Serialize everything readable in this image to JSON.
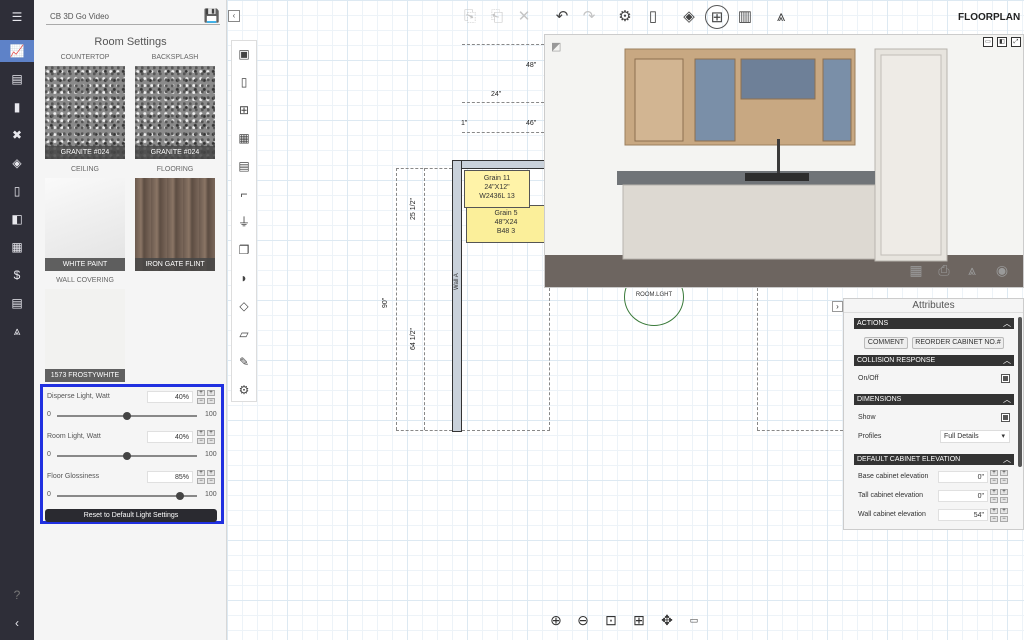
{
  "app": {
    "mode_label": "FLOORPLAN"
  },
  "project": {
    "name": "CB 3D Go Video"
  },
  "nav": {
    "items": [
      {
        "name": "menu-icon",
        "glyph": "☰"
      },
      {
        "name": "chart-icon",
        "glyph": "📈"
      },
      {
        "name": "document-icon",
        "glyph": "▤"
      },
      {
        "name": "book-icon",
        "glyph": "▮"
      },
      {
        "name": "tools-icon",
        "glyph": "✖"
      },
      {
        "name": "layers-icon",
        "glyph": "◈"
      },
      {
        "name": "page-icon",
        "glyph": "▯"
      },
      {
        "name": "panel-icon",
        "glyph": "◧"
      },
      {
        "name": "grid-icon",
        "glyph": "▦"
      },
      {
        "name": "dollar-icon",
        "glyph": "$"
      },
      {
        "name": "report-icon",
        "glyph": "▤"
      },
      {
        "name": "compass-icon",
        "glyph": "⩓"
      }
    ],
    "help_glyph": "?",
    "collapse_glyph": "‹"
  },
  "room_settings": {
    "title": "Room Settings",
    "swatches": {
      "countertop": {
        "label": "COUNTERTOP",
        "value": "GRANITE #024"
      },
      "backsplash": {
        "label": "BACKSPLASH",
        "value": "GRANITE #024"
      },
      "ceiling": {
        "label": "CEILING",
        "value": "WHITE PAINT"
      },
      "flooring": {
        "label": "FLOORING",
        "value": "IRON GATE FLINT"
      },
      "wall_covering": {
        "label": "WALL COVERING",
        "value": "1573 FROSTYWHITE"
      }
    },
    "lights": [
      {
        "label": "Disperse Light, Watt",
        "value": "40%",
        "min": "0",
        "max": "100",
        "level": 0.5
      },
      {
        "label": "Room Light, Watt",
        "value": "40%",
        "min": "0",
        "max": "100",
        "level": 0.5
      },
      {
        "label": "Floor Glossiness",
        "value": "85%",
        "min": "0",
        "max": "100",
        "level": 0.9
      }
    ],
    "reset_label": "Reset to Default Light Settings"
  },
  "floorplan": {
    "dims": {
      "d48": "48\"",
      "d24": "24\"",
      "d1": "1\"",
      "d46": "46\"",
      "d25": "25 1/2\"",
      "d90": "90\"",
      "d64": "64 1/2\""
    },
    "wall_label": "Wall A",
    "cab_upper": {
      "line1": "Grain 11",
      "line2": "24\"X12\"",
      "line3": "W2436L 13"
    },
    "cab_base": {
      "line1": "Grain 5",
      "line2": "48\"X24",
      "line3": "B48 3"
    },
    "room_light": "ROOM.LGHT"
  },
  "attributes": {
    "title": "Attributes",
    "sections": {
      "actions": "ACTIONS",
      "collision": "COLLISION RESPONSE",
      "dimensions": "DIMENSIONS",
      "elevation": "DEFAULT CABINET ELEVATION"
    },
    "comment_btn": "COMMENT",
    "reorder_btn": "REORDER CABINET NO.#",
    "onoff_label": "On/Off",
    "show_label": "Show",
    "profiles_label": "Profiles",
    "profiles_value": "Full Details",
    "base_label": "Base cabinet elevation",
    "base_value": "0\"",
    "tall_label": "Tall cabinet elevation",
    "tall_value": "0\"",
    "wall_label": "Wall cabinet elevation",
    "wall_value": "54\""
  }
}
